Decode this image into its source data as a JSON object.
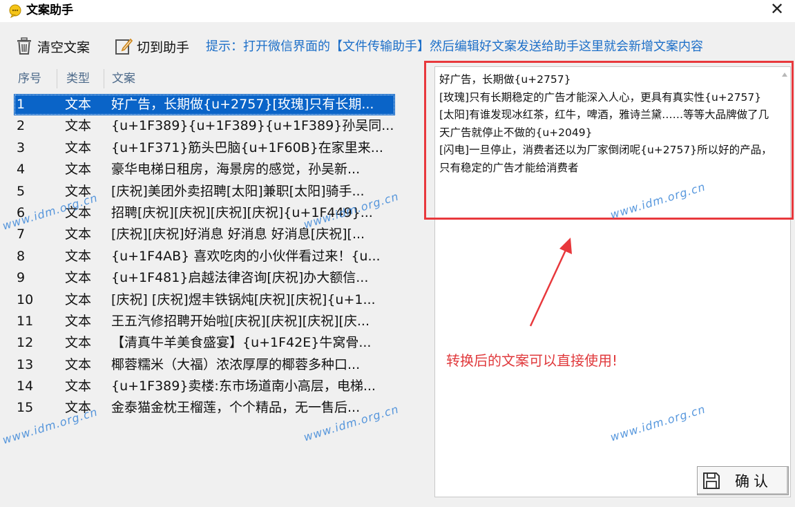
{
  "window": {
    "title": "文案助手",
    "close_glyph": "✕"
  },
  "toolbar": {
    "clear_label": "清空文案",
    "switch_label": "切到助手",
    "hint": "提示：打开微信界面的【文件传输助手】然后编辑好文案发送给助手这里就会新增文案内容"
  },
  "list": {
    "headers": {
      "no": "序号",
      "type": "类型",
      "text": "文案"
    },
    "selected_index": 0,
    "rows": [
      {
        "no": "1",
        "type": "文本",
        "text": "好广告，长期做{u+2757}[玫瑰]只有长期..."
      },
      {
        "no": "2",
        "type": "文本",
        "text": "{u+1F389}{u+1F389}{u+1F389}孙吴同..."
      },
      {
        "no": "3",
        "type": "文本",
        "text": "{u+1F371}筋头巴脑{u+1F60B}在家里来..."
      },
      {
        "no": "4",
        "type": "文本",
        "text": "豪华电梯日租房，海景房的感觉，孙吴新..."
      },
      {
        "no": "5",
        "type": "文本",
        "text": "[庆祝]美团外卖招聘[太阳]兼职[太阳]骑手..."
      },
      {
        "no": "6",
        "type": "文本",
        "text": "招聘[庆祝][庆祝][庆祝][庆祝]{u+1F449}..."
      },
      {
        "no": "7",
        "type": "文本",
        "text": "[庆祝][庆祝]好消息 好消息 好消息[庆祝][..."
      },
      {
        "no": "8",
        "type": "文本",
        "text": "{u+1F4AB} 喜欢吃肉的小伙伴看过来！{u..."
      },
      {
        "no": "9",
        "type": "文本",
        "text": "{u+1F481}启越法律咨询[庆祝]办大额信..."
      },
      {
        "no": "10",
        "type": "文本",
        "text": "[庆祝] [庆祝]煜丰铁锅炖[庆祝][庆祝]{u+1..."
      },
      {
        "no": "11",
        "type": "文本",
        "text": "王五汽修招聘开始啦[庆祝][庆祝][庆祝][庆..."
      },
      {
        "no": "12",
        "type": "文本",
        "text": "【清真牛羊美食盛宴】{u+1F42E}牛窝骨..."
      },
      {
        "no": "13",
        "type": "文本",
        "text": "椰蓉糯米（大福）浓浓厚厚的椰蓉多种口..."
      },
      {
        "no": "14",
        "type": "文本",
        "text": "{u+1F389}卖楼:东市场道南小高层，电梯..."
      },
      {
        "no": "15",
        "type": "文本",
        "text": "金泰猫金枕王榴莲，个个精品，无一售后..."
      }
    ]
  },
  "preview": {
    "content": "好广告，长期做{u+2757}\n[玫瑰]只有长期稳定的广告才能深入人心，更具有真实性{u+2757}\n[太阳]有谁发现冰红茶，红牛，啤酒，雅诗兰黛……等等大品牌做了几天广告就停止不做的{u+2049}\n[闪电]一旦停止，消费者还以为厂家倒闭呢{u+2757}所以好的产品，只有稳定的广告才能给消费者"
  },
  "annotation": {
    "text": "转换后的文案可以直接使用!",
    "color": "#e0393c"
  },
  "confirm_button": {
    "label": "确认"
  },
  "watermark": {
    "text": "www.idm.org.cn"
  },
  "colors": {
    "accent": "#0a64c8",
    "hint": "#1d6fc8",
    "highlight": "#e8383c"
  },
  "icons": {
    "app": "chat-bubble-icon",
    "clear": "trash-icon",
    "switch": "edit-icon",
    "save": "floppy-disk-icon",
    "close": "close-icon"
  }
}
